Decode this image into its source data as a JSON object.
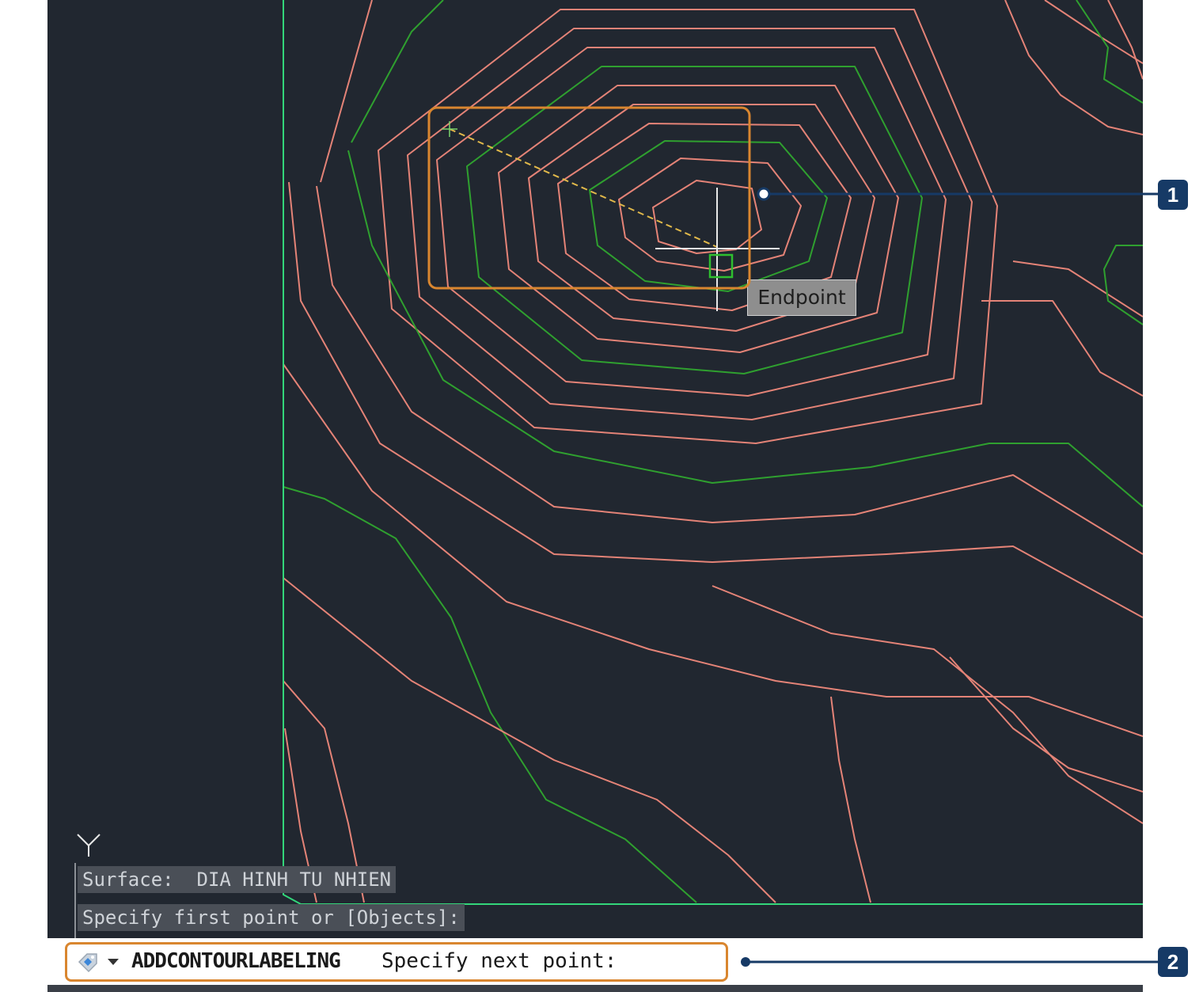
{
  "viewport": {
    "background": "#212730",
    "contour_colors": {
      "minor": "#e48377",
      "major": "#2fa02f",
      "boundary": "#33d67a"
    }
  },
  "snap": {
    "tooltip": "Endpoint",
    "marker_icon": "endpoint-snap-square-icon"
  },
  "ucs": {
    "axis_label": "Y"
  },
  "history": {
    "line1": "Surface:  DIA HINH TU NHIEN",
    "line2": "Specify first point or [Objects]:"
  },
  "command_line": {
    "icon": "command-tag-icon",
    "dropdown_icon": "chevron-down-icon",
    "command": "ADDCONTOURLABELING",
    "prompt": "Specify next point:"
  },
  "callouts": [
    {
      "number": "1"
    },
    {
      "number": "2"
    }
  ],
  "colors": {
    "highlight": "#d9862f",
    "callout": "#163a66",
    "rubber_band": "#e0b84a"
  }
}
